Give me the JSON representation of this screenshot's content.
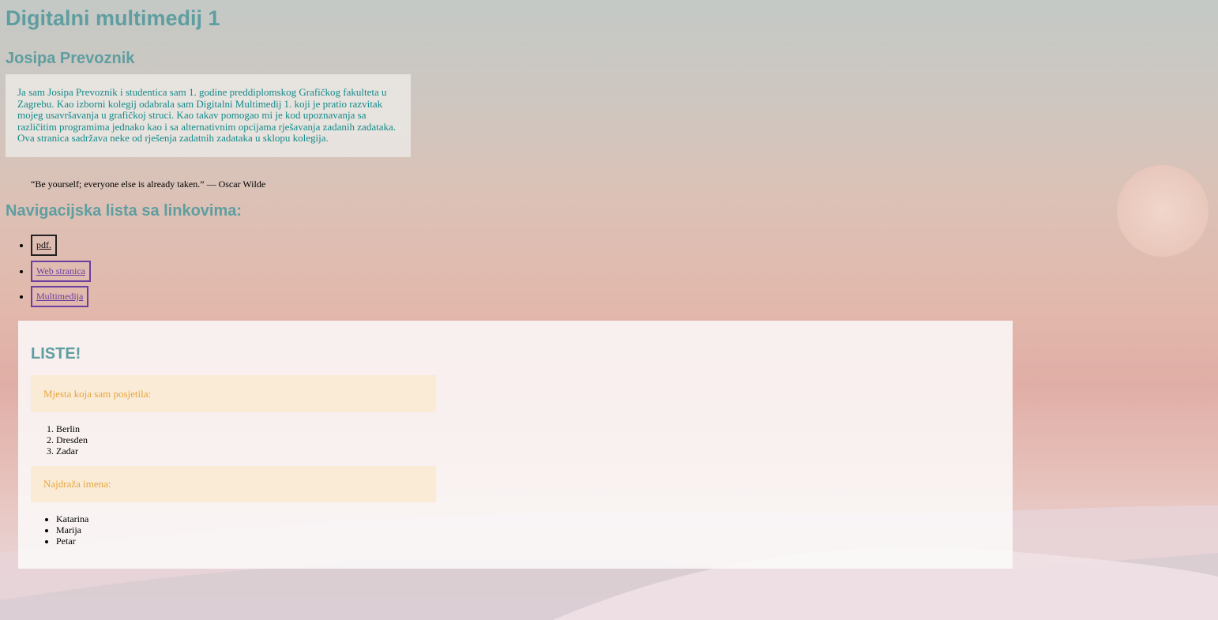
{
  "page": {
    "title": "Digitalni multimedij 1",
    "author": "Josipa Prevoznik",
    "intro": "Ja sam Josipa Prevoznik i studentica sam 1. godine preddiplomskog Grafičkog fakulteta u Zagrebu. Kao izborni kolegij odabrala sam Digitalni Multimedij 1. koji je pratio razvitak mojeg usavršavanja u grafičkoj struci. Kao takav pomogao mi je kod upoznavanja sa različitim programima jednako kao i sa alternativnim opcijama rješavanja zadanih zadataka. Ova stranica sadržava neke od rješenja zadatnih zadataka u sklopu kolegija.",
    "quote": "“Be yourself; everyone else is already taken.” — Oscar Wilde"
  },
  "nav": {
    "heading": "Navigacijska lista sa linkovima:",
    "links": [
      {
        "label": "pdf."
      },
      {
        "label": "Web stranica"
      },
      {
        "label": "Multimedija"
      }
    ]
  },
  "lists": {
    "heading": "LISTE!",
    "places_label": "Mjesta koja sam posjetila:",
    "places": [
      "Berlin",
      "Dresden",
      "Zadar"
    ],
    "names_label": "Najdraža imena:",
    "names": [
      "Katarina",
      "Marija",
      "Petar"
    ]
  },
  "colors": {
    "heading": "#5f9ea0",
    "intro_text": "#148a8a",
    "link": "#6b3f9f",
    "label_box_bg": "#faebd7",
    "label_text": "#e7a53a"
  }
}
